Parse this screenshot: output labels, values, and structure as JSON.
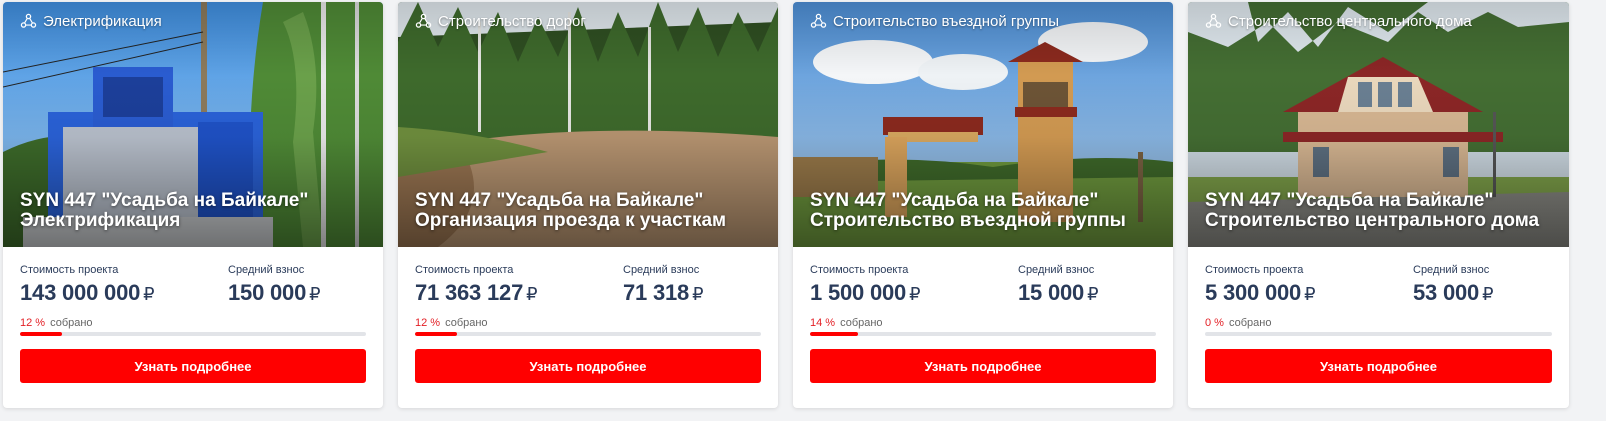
{
  "colors": {
    "accent": "#ff0000",
    "text": "#2a3b5a",
    "track": "#e2e4e8"
  },
  "cards": [
    {
      "category_icon": "group-icon",
      "category": "Электрификация",
      "title_line1": "SYN 447 \"Усадьба на Байкале\"",
      "title_line2": "Электрификация",
      "cost_label": "Стоимость проекта",
      "cost_value": "143 000 000",
      "avg_label": "Средний взнос",
      "avg_value": "150 000",
      "currency": "₽",
      "percent_text": "12 %",
      "collected_label": "собрано",
      "progress": 0.12,
      "button_label": "Узнать подробнее"
    },
    {
      "category_icon": "group-icon",
      "category": "Строительство дорог",
      "title_line1": "SYN 447 \"Усадьба на Байкале\"",
      "title_line2": "Организация проезда к участкам",
      "cost_label": "Стоимость проекта",
      "cost_value": "71 363 127",
      "avg_label": "Средний взнос",
      "avg_value": "71 318",
      "currency": "₽",
      "percent_text": "12 %",
      "collected_label": "собрано",
      "progress": 0.12,
      "button_label": "Узнать подробнее"
    },
    {
      "category_icon": "group-icon",
      "category": "Строительство въездной группы",
      "title_line1": "SYN 447 \"Усадьба на Байкале\"",
      "title_line2": "Строительство въездной группы",
      "cost_label": "Стоимость проекта",
      "cost_value": "1 500 000",
      "avg_label": "Средний взнос",
      "avg_value": "15 000",
      "currency": "₽",
      "percent_text": "14 %",
      "collected_label": "собрано",
      "progress": 0.14,
      "button_label": "Узнать подробнее"
    },
    {
      "category_icon": "group-icon",
      "category": "Строительство центрального дома",
      "title_line1": "SYN 447 \"Усадьба на Байкале\"",
      "title_line2": "Строительство центрального дома",
      "cost_label": "Стоимость проекта",
      "cost_value": "5 300 000",
      "avg_label": "Средний взнос",
      "avg_value": "53 000",
      "currency": "₽",
      "percent_text": "0 %",
      "collected_label": "собрано",
      "progress": 0.0,
      "button_label": "Узнать подробнее"
    }
  ]
}
